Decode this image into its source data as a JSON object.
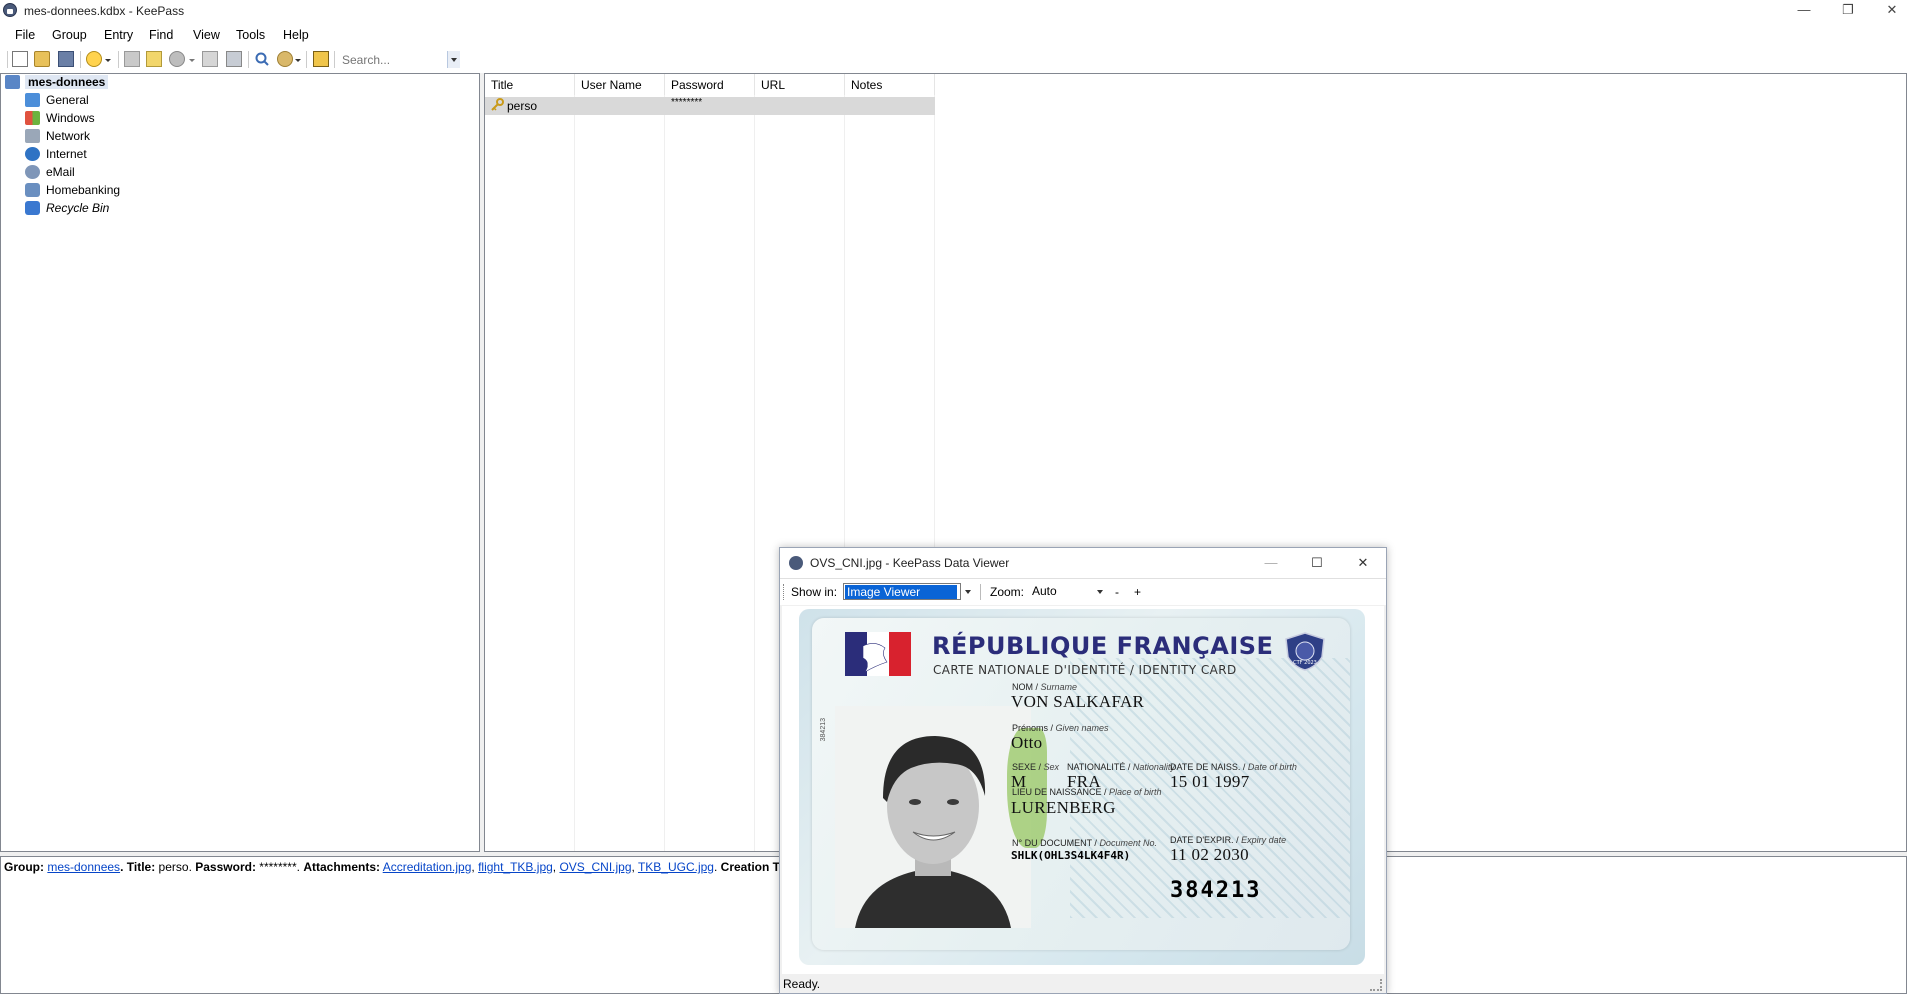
{
  "window": {
    "title": "mes-donnees.kdbx - KeePass",
    "minimize": "—",
    "restore": "❐",
    "close": "✕"
  },
  "menu": [
    "File",
    "Group",
    "Entry",
    "Find",
    "View",
    "Tools",
    "Help"
  ],
  "toolbar": {
    "search_placeholder": "Search..."
  },
  "tree": {
    "root": "mes-donnees",
    "groups": [
      {
        "label": "General",
        "icon": "folder-icon"
      },
      {
        "label": "Windows",
        "icon": "windows-icon"
      },
      {
        "label": "Network",
        "icon": "network-icon"
      },
      {
        "label": "Internet",
        "icon": "globe-icon"
      },
      {
        "label": "eMail",
        "icon": "email-icon"
      },
      {
        "label": "Homebanking",
        "icon": "homebanking-icon"
      },
      {
        "label": "Recycle Bin",
        "icon": "recycle-bin-icon"
      }
    ]
  },
  "list": {
    "columns": [
      "Title",
      "User Name",
      "Password",
      "URL",
      "Notes"
    ],
    "rows": [
      {
        "title": "perso",
        "username": "",
        "password": "********",
        "url": "",
        "notes": ""
      }
    ]
  },
  "details": {
    "group_label": "Group:",
    "group_value": "mes-donnees",
    "title_label": "Title:",
    "title_value": "perso.",
    "password_label": "Password:",
    "password_value": "********.",
    "attachments_label": "Attachments:",
    "attachments": [
      "Accreditation.jpg",
      "flight_TKB.jpg",
      "OVS_CNI.jpg",
      "TKB_UGC.jpg"
    ],
    "creation_label": "Creation Time:"
  },
  "viewer": {
    "title": "OVS_CNI.jpg - KeePass Data Viewer",
    "show_in_label": "Show in:",
    "show_in_value": "Image Viewer",
    "zoom_label": "Zoom:",
    "zoom_value": "Auto",
    "zoom_minus": "-",
    "zoom_plus": "+",
    "status": "Ready.",
    "minimize": "—",
    "maximize": "☐",
    "close": "✕"
  },
  "id_card": {
    "header": "RÉPUBLIQUE FRANÇAISE",
    "subheader": "CARTE NATIONALE D'IDENTITÉ / IDENTITY CARD",
    "surname_label": "NOM / ",
    "surname_label_en": "Surname",
    "surname": "VON SALKAFAR",
    "given_label": "Prénoms / ",
    "given_label_en": "Given names",
    "given": "Otto",
    "sex_label": "SEXE / ",
    "sex_label_en": "Sex",
    "sex": "M",
    "nationality_label": "NATIONALITÉ / ",
    "nationality_label_en": "Nationality",
    "nationality": "FRA",
    "dob_label": "DATE DE NAISS. / ",
    "dob_label_en": "Date of birth",
    "dob": "15 01 1997",
    "pob_label": "LIEU DE NAISSANCE / ",
    "pob_label_en": "Place of birth",
    "pob": "LURENBERG",
    "docno_label": "N° DU DOCUMENT / ",
    "docno_label_en": "Document No.",
    "docno": "SHLK(OHL3S4LK4F4R)",
    "expiry_label": "DATE D'EXPIR. / ",
    "expiry_label_en": "Expiry date",
    "expiry": "11 02 2030",
    "card_number": "384213",
    "badge_text": "CTF 2023"
  }
}
